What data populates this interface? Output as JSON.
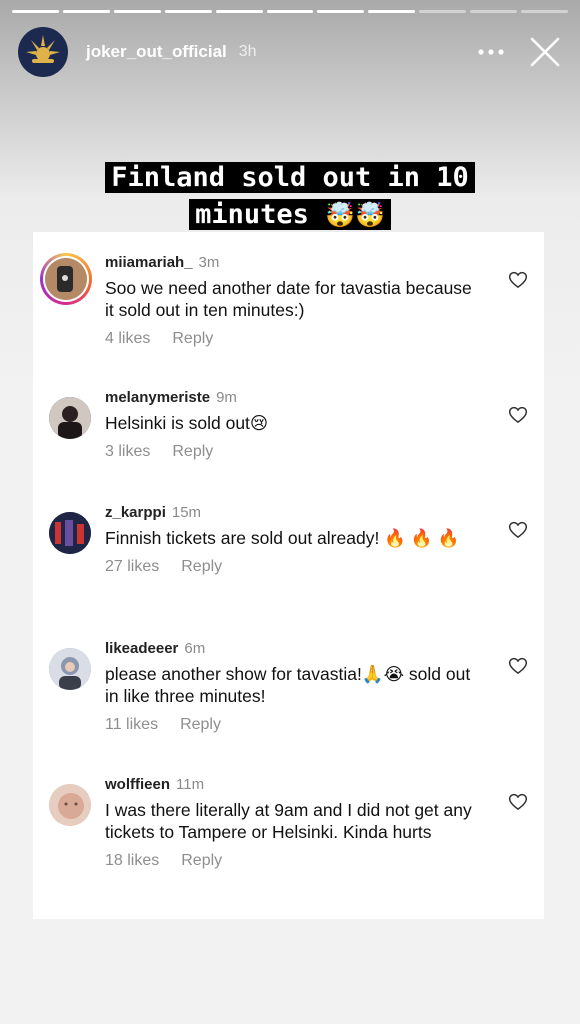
{
  "story": {
    "progress_segments": 11,
    "progress_done": 8,
    "username": "joker_out_official",
    "time": "3h",
    "headline_line1": "Finland sold out in 10",
    "headline_line2": "minutes",
    "headline_emoji": "🤯🤯"
  },
  "comments": [
    {
      "user": "miiamariah_",
      "time": "3m",
      "text": "Soo we need another date for tavastia because it sold out in ten minutes:)",
      "likes": "4 likes",
      "reply": "Reply",
      "avatar_color": "#c7a27e"
    },
    {
      "user": "melanymeriste",
      "time": "9m",
      "text": "Helsinki is sold out😢",
      "likes": "3 likes",
      "reply": "Reply",
      "avatar_color": "#3a3030"
    },
    {
      "user": "z_karppi",
      "time": "15m",
      "text": "Finnish tickets are sold out already! 🔥 🔥 🔥",
      "likes": "27 likes",
      "reply": "Reply",
      "avatar_color": "#2a2f4e"
    },
    {
      "user": "likeadeeer",
      "time": "6m",
      "text": "please another show for tavastia!🙏😭 sold out in like three minutes!",
      "likes": "11 likes",
      "reply": "Reply",
      "avatar_color": "#8c96a8"
    },
    {
      "user": "wolffieen",
      "time": "11m",
      "text": "I was there literally at 9am and I did not get any tickets to Tampere or Helsinki. Kinda hurts",
      "likes": "18 likes",
      "reply": "Reply",
      "avatar_color": "#d9b7a6"
    }
  ],
  "colors": {
    "accent_ring": "#d62a8a",
    "meta_gray": "#8e8e8e"
  }
}
